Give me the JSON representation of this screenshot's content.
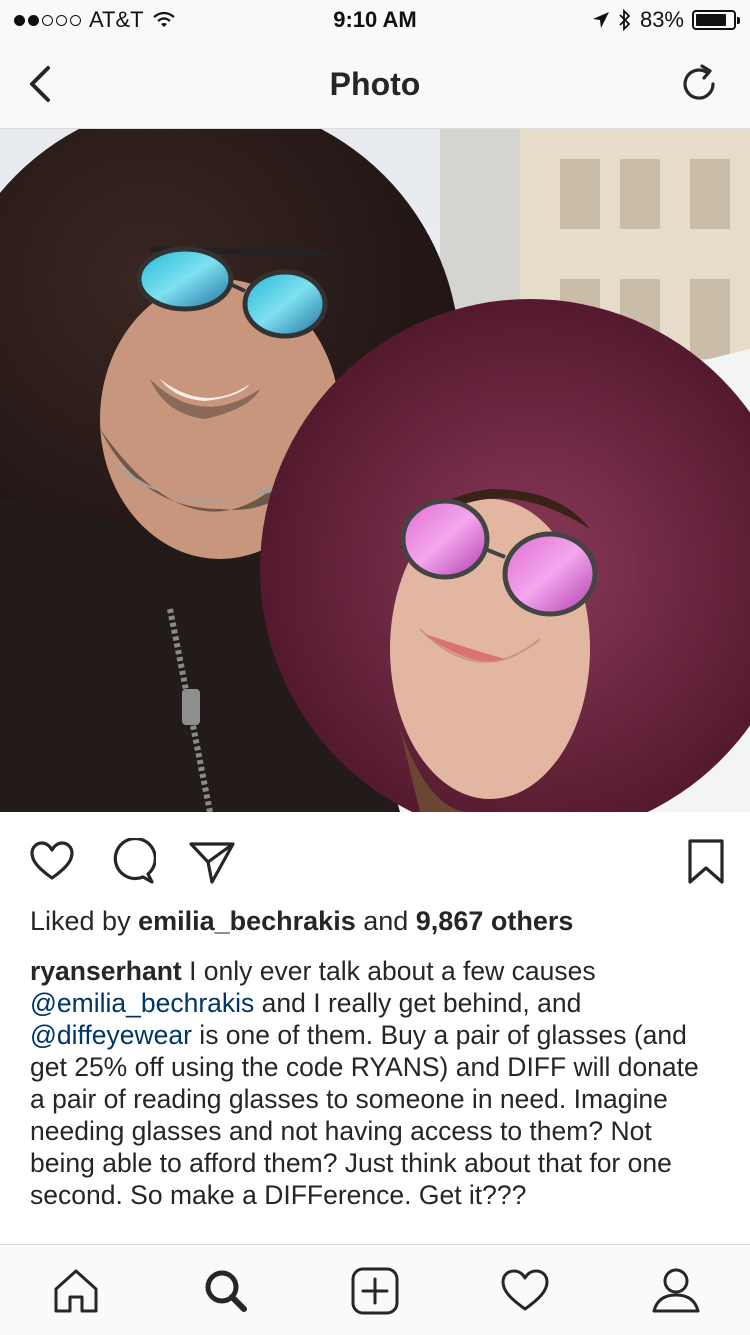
{
  "status": {
    "carrier": "AT&T",
    "time": "9:10 AM",
    "battery": "83%",
    "battery_level": 0.83
  },
  "nav": {
    "title": "Photo"
  },
  "post": {
    "likes": {
      "prefix": "Liked by ",
      "user": "emilia_bechrakis",
      "middle": " and ",
      "count": "9,867 others"
    },
    "caption": {
      "username": "ryanserhant",
      "t1": " I only ever talk about a few causes ",
      "mention1": "@emilia_bechrakis",
      "t2": " and I really get behind, and ",
      "mention2": "@diffeyewear",
      "t3": " is one of them. Buy a pair of glasses (and get 25% off using the code RYANS) and DIFF will donate a pair of reading glasses to someone in need. Imagine needing glasses and not having access to them? Not being able to afford them? Just think about that for one second. So make a DIFFerence. Get it???"
    }
  },
  "icons": {
    "back": "chevron-left-icon",
    "refresh": "refresh-icon",
    "like": "heart-icon",
    "comment": "comment-icon",
    "share": "paper-plane-icon",
    "save": "bookmark-icon",
    "home": "home-icon",
    "search": "search-icon",
    "add": "plus-square-icon",
    "activity": "heart-icon",
    "profile": "person-icon"
  },
  "colors": {
    "mention": "#003569",
    "text": "#262626",
    "bar_bg": "#f9f9f9"
  }
}
